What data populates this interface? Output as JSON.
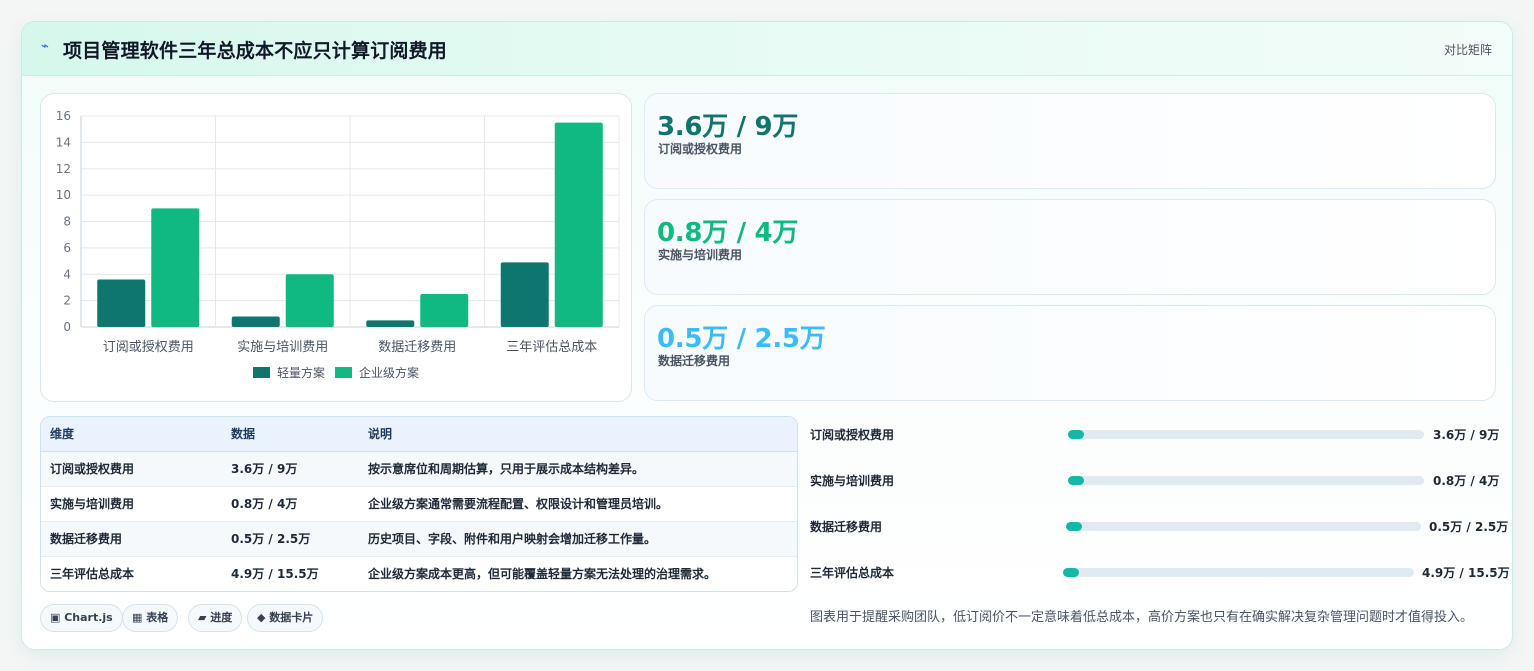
{
  "header": {
    "icon": "bolt-icon",
    "title": "项目管理软件三年总成本不应只计算订阅费用",
    "link_label": "对比矩阵"
  },
  "chart_data": {
    "type": "bar",
    "categories": [
      "订阅或授权费用",
      "实施与培训费用",
      "数据迁移费用",
      "三年评估总成本"
    ],
    "series": [
      {
        "name": "轻量方案",
        "values": [
          3.6,
          0.8,
          0.5,
          4.9
        ],
        "color": "#0f766e"
      },
      {
        "name": "企业级方案",
        "values": [
          9,
          4,
          2.5,
          15.5
        ],
        "color": "#10b981"
      }
    ],
    "ylim": [
      0,
      16
    ],
    "yticks": [
      0,
      2,
      4,
      6,
      8,
      10,
      12,
      14,
      16
    ],
    "grid": true,
    "legend": "bottom"
  },
  "stats": [
    {
      "value": "3.6万 / 9万",
      "label": "订阅或授权费用",
      "color": "#0f766e"
    },
    {
      "value": "0.8万 / 4万",
      "label": "实施与培训费用",
      "color": "#10b981"
    },
    {
      "value": "0.5万 / 2.5万",
      "label": "数据迁移费用",
      "color": "#38bdf8"
    }
  ],
  "table": {
    "headers": [
      "维度",
      "数据",
      "说明"
    ],
    "rows": [
      [
        "订阅或授权费用",
        "3.6万 / 9万",
        "按示意席位和周期估算，只用于展示成本结构差异。"
      ],
      [
        "实施与培训费用",
        "0.8万 / 4万",
        "企业级方案通常需要流程配置、权限设计和管理员培训。"
      ],
      [
        "数据迁移费用",
        "0.5万 / 2.5万",
        "历史项目、字段、附件和用户映射会增加迁移工作量。"
      ],
      [
        "三年评估总成本",
        "4.9万 / 15.5万",
        "企业级方案成本更高，但可能覆盖轻量方案无法处理的治理需求。"
      ]
    ]
  },
  "chips": [
    {
      "label": "▣ Chart.js"
    },
    {
      "label": "▦ 表格"
    },
    {
      "label": "▰ 进度"
    },
    {
      "label": "◆ 数据卡片"
    }
  ],
  "progress": [
    {
      "label": "订阅或授权费用",
      "value": "3.6万 / 9万",
      "fraction": 0.03
    },
    {
      "label": "实施与培训费用",
      "value": "0.8万 / 4万",
      "fraction": 0.03
    },
    {
      "label": "数据迁移费用",
      "value": "0.5万 / 2.5万",
      "fraction": 0.03
    },
    {
      "label": "三年评估总成本",
      "value": "4.9万 / 15.5万",
      "fraction": 0.03
    }
  ],
  "note": "图表用于提醒采购团队，低订阅价不一定意味着低总成本，高价方案也只有在确实解决复杂管理问题时才值得投入。"
}
